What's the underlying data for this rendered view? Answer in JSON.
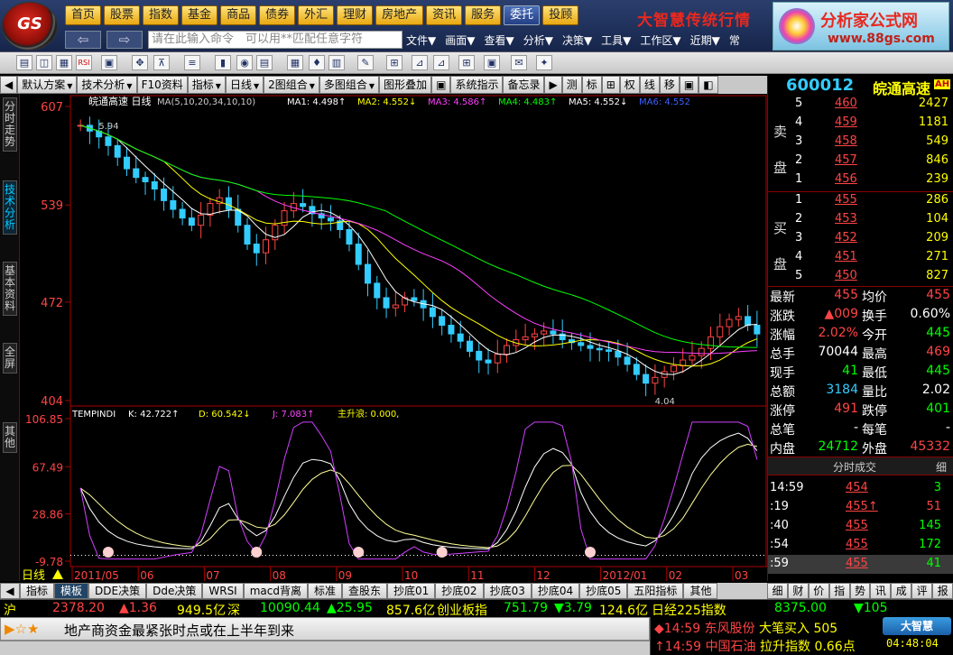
{
  "top": {
    "logo_text": "GS",
    "menu": [
      {
        "label": "首页",
        "style": "gold"
      },
      {
        "label": "股票",
        "style": "gold"
      },
      {
        "label": "指数",
        "style": "gold"
      },
      {
        "label": "基金",
        "style": "gold"
      },
      {
        "label": "商品",
        "style": "gold"
      },
      {
        "label": "债券",
        "style": "gold"
      },
      {
        "label": "外汇",
        "style": "gold"
      },
      {
        "label": "理财",
        "style": "gold"
      },
      {
        "label": "房地产",
        "style": "gold"
      },
      {
        "label": "资讯",
        "style": "gold"
      },
      {
        "label": "服务",
        "style": "gold"
      },
      {
        "label": "委托",
        "style": "blue"
      },
      {
        "label": "投顾",
        "style": "gold"
      }
    ],
    "brand_left": "大智慧传统行情",
    "brand_right": "分析家公式网",
    "brand_url": "www.88gs.com",
    "back": "⇦",
    "forward": "⇨",
    "command_placeholder": "请在此输入命令　可以用**匹配任意字符",
    "menu2": [
      "文件▼",
      "画面▼",
      "查看▼",
      "分析▼",
      "决策▼",
      "工具▼",
      "工作区▼",
      "近期▼",
      "常"
    ]
  },
  "toolbar_icons": [
    "▤",
    "◫",
    "▦",
    "RSI",
    "▣",
    "✥",
    "⊼",
    "≡",
    "▮",
    "◉",
    "▤",
    "▦",
    "♦",
    "▥",
    "✎",
    "⊞",
    "⊿",
    "⊿",
    "⊞",
    "▣",
    "✉",
    "✦"
  ],
  "tabs": [
    {
      "label": "◀",
      "dd": false
    },
    {
      "label": "默认方案",
      "dd": true
    },
    {
      "label": "技术分析",
      "dd": true
    },
    {
      "label": "F10资料",
      "dd": false
    },
    {
      "label": "指标",
      "dd": true
    },
    {
      "label": "日线",
      "dd": true
    },
    {
      "label": "2图组合",
      "dd": true
    },
    {
      "label": "多图组合",
      "dd": true
    },
    {
      "label": "图形叠加",
      "dd": false
    },
    {
      "label": "▣",
      "dd": false
    },
    {
      "label": "系统指示",
      "dd": false
    },
    {
      "label": "备忘录",
      "dd": false
    },
    {
      "label": "▶",
      "dd": false
    },
    {
      "label": "测",
      "dd": false
    },
    {
      "label": "标",
      "dd": false
    },
    {
      "label": "⊞",
      "dd": false
    },
    {
      "label": "权",
      "dd": false
    },
    {
      "label": "线",
      "dd": false
    },
    {
      "label": "移",
      "dd": false
    },
    {
      "label": "▣",
      "dd": false
    },
    {
      "label": "◧",
      "dd": false
    }
  ],
  "leftbar": [
    {
      "label": "分时走势",
      "active": false
    },
    {
      "label": "技术分析",
      "active": true
    },
    {
      "label": "基本资料",
      "active": false
    },
    {
      "label": "全屏",
      "active": false
    },
    {
      "label": "其他",
      "active": false
    }
  ],
  "chart_data": {
    "type": "candlestick",
    "title": "皖通高速 日线",
    "ma_header": "MA(5,10,20,34,10,10)",
    "ma_values": [
      {
        "name": "MA1",
        "value": "4.498↑",
        "color": "#ffffff"
      },
      {
        "name": "MA2",
        "value": "4.552↓",
        "color": "#ffff00"
      },
      {
        "name": "MA3",
        "value": "4.586↑",
        "color": "#ff40ff"
      },
      {
        "name": "MA4",
        "value": "4.483↑",
        "color": "#00ff00"
      },
      {
        "name": "MA5",
        "value": "4.552↓",
        "color": "#ffffff"
      },
      {
        "name": "MA6",
        "value": "4.552",
        "color": "#4060ff"
      }
    ],
    "price_ticks": [
      "607",
      "539",
      "472",
      "404"
    ],
    "price_range": [
      4.04,
      6.07
    ],
    "annotations": {
      "high": "5.94",
      "low": "4.04"
    },
    "x_labels": [
      "2011/05",
      "06",
      "07",
      "08",
      "09",
      "10",
      "11",
      "12",
      "2012/01",
      "02",
      "03"
    ],
    "bottom_label": "日线",
    "kdj": {
      "header_name": "TEMPINDI",
      "k": "K: 42.722↑",
      "d": "D: 60.542↓",
      "j": "J: 7.083↑",
      "main": "主升浪: 0.000,",
      "ticks": [
        "106.85",
        "67.49",
        "28.86",
        "-9.78"
      ],
      "range": [
        -9.78,
        106.85
      ]
    },
    "close_series": [
      5.94,
      5.9,
      5.86,
      5.8,
      5.72,
      5.64,
      5.58,
      5.55,
      5.5,
      5.42,
      5.36,
      5.3,
      5.25,
      5.32,
      5.4,
      5.44,
      5.36,
      5.25,
      5.12,
      5.06,
      5.15,
      5.25,
      5.35,
      5.4,
      5.38,
      5.33,
      5.3,
      5.28,
      5.22,
      5.12,
      4.98,
      4.85,
      4.75,
      4.68,
      4.7,
      4.75,
      4.73,
      4.68,
      4.62,
      4.56,
      4.5,
      4.45,
      4.38,
      4.32,
      4.3,
      4.36,
      4.42,
      4.46,
      4.48,
      4.5,
      4.52,
      4.5,
      4.46,
      4.44,
      4.42,
      4.4,
      4.39,
      4.38,
      4.34,
      4.29,
      4.22,
      4.16,
      4.2,
      4.24,
      4.28,
      4.32,
      4.35,
      4.4,
      4.48,
      4.55,
      4.6,
      4.62,
      4.56,
      4.5
    ]
  },
  "right": {
    "code": "600012",
    "name": "皖通高速",
    "ah": "AH",
    "sell_label": "卖盘",
    "buy_label": "买盘",
    "sell": [
      {
        "lvl": "5",
        "price": "460",
        "vol": "2427"
      },
      {
        "lvl": "4",
        "price": "459",
        "vol": "1181"
      },
      {
        "lvl": "3",
        "price": "458",
        "vol": "549"
      },
      {
        "lvl": "2",
        "price": "457",
        "vol": "846"
      },
      {
        "lvl": "1",
        "price": "456",
        "vol": "239"
      }
    ],
    "buy": [
      {
        "lvl": "1",
        "price": "455",
        "vol": "286"
      },
      {
        "lvl": "2",
        "price": "453",
        "vol": "104"
      },
      {
        "lvl": "3",
        "price": "452",
        "vol": "209"
      },
      {
        "lvl": "4",
        "price": "451",
        "vol": "271"
      },
      {
        "lvl": "5",
        "price": "450",
        "vol": "827"
      }
    ],
    "quotes": [
      {
        "l1": "最新",
        "v1": "455",
        "c1": "red",
        "l2": "均价",
        "v2": "455",
        "c2": "red"
      },
      {
        "l1": "涨跌",
        "v1": "▲009",
        "c1": "red",
        "l2": "换手",
        "v2": "0.60%",
        "c2": "wht"
      },
      {
        "l1": "涨幅",
        "v1": "2.02%",
        "c1": "red",
        "l2": "今开",
        "v2": "445",
        "c2": "grn"
      },
      {
        "l1": "总手",
        "v1": "70044",
        "c1": "wht",
        "l2": "最高",
        "v2": "469",
        "c2": "red"
      },
      {
        "l1": "现手",
        "v1": "41",
        "c1": "grn",
        "l2": "最低",
        "v2": "445",
        "c2": "grn"
      },
      {
        "l1": "总额",
        "v1": "3184",
        "c1": "cyn",
        "l2": "量比",
        "v2": "2.02",
        "c2": "wht"
      },
      {
        "l1": "涨停",
        "v1": "491",
        "c1": "red",
        "l2": "跌停",
        "v2": "401",
        "c2": "grn"
      },
      {
        "l1": "总笔",
        "v1": "-",
        "c1": "wht",
        "l2": "每笔",
        "v2": "-",
        "c2": "wht"
      },
      {
        "l1": "内盘",
        "v1": "24712",
        "c1": "grn",
        "l2": "外盘",
        "v2": "45332",
        "c2": "red"
      }
    ],
    "fenshi_title": "分时成交",
    "fenshi_tab": "细",
    "trades": [
      {
        "t": "14:59",
        "p": "454",
        "v": "3",
        "pc": "red",
        "vc": "grn"
      },
      {
        "t": ":19",
        "p": "455↑",
        "v": "51",
        "pc": "red",
        "vc": "red"
      },
      {
        "t": ":40",
        "p": "455",
        "v": "145",
        "pc": "red",
        "vc": "grn"
      },
      {
        "t": ":54",
        "p": "455",
        "v": "172",
        "pc": "red",
        "vc": "grn"
      },
      {
        "t": ":59",
        "p": "455",
        "v": "41",
        "pc": "red",
        "vc": "grn"
      }
    ],
    "tabs": [
      "细",
      "财",
      "价",
      "指",
      "势",
      "讯",
      "成",
      "评",
      "报"
    ]
  },
  "bottom_tabs": [
    "指标",
    "模板",
    "DDE决策",
    "Dde决策",
    "WRSI",
    "macd背离",
    "标准",
    "查股东",
    "抄底01",
    "抄底02",
    "抄底03",
    "抄底04",
    "抄底05",
    "五阳指标",
    "其他"
  ],
  "bottom_tabs_active": "模板",
  "left_tab": "◀",
  "ticker": {
    "sh_label": "沪",
    "sh_val": "2378.20",
    "sh_chg": "▲1.36",
    "sh_amt": "949.5亿",
    "sz_label": "深",
    "sz_val": "10090.44",
    "sz_chg": "▲25.95",
    "sz_amt": "857.6亿",
    "cy_label": "创业板指",
    "cy_val": "751.79",
    "cy_chg": "▼3.79",
    "cy_amt": "124.6亿",
    "nk_label": "日经225指数",
    "nk_val": "8375.00",
    "nk_chg": "▼105"
  },
  "news": {
    "icons": "▶☆★",
    "text": "地产商资金最紧张时点或在上半年到来",
    "alert1_time": "◆14:59",
    "alert1_name": "东风股份",
    "alert1_msg": "大笔买入",
    "alert1_val": "505",
    "alert2_time": "↑14:59",
    "alert2_name": "中国石油",
    "alert2_msg": "拉升指数",
    "alert2_val": "0.66点",
    "brand": "大智慧",
    "time": "04:48:04"
  }
}
